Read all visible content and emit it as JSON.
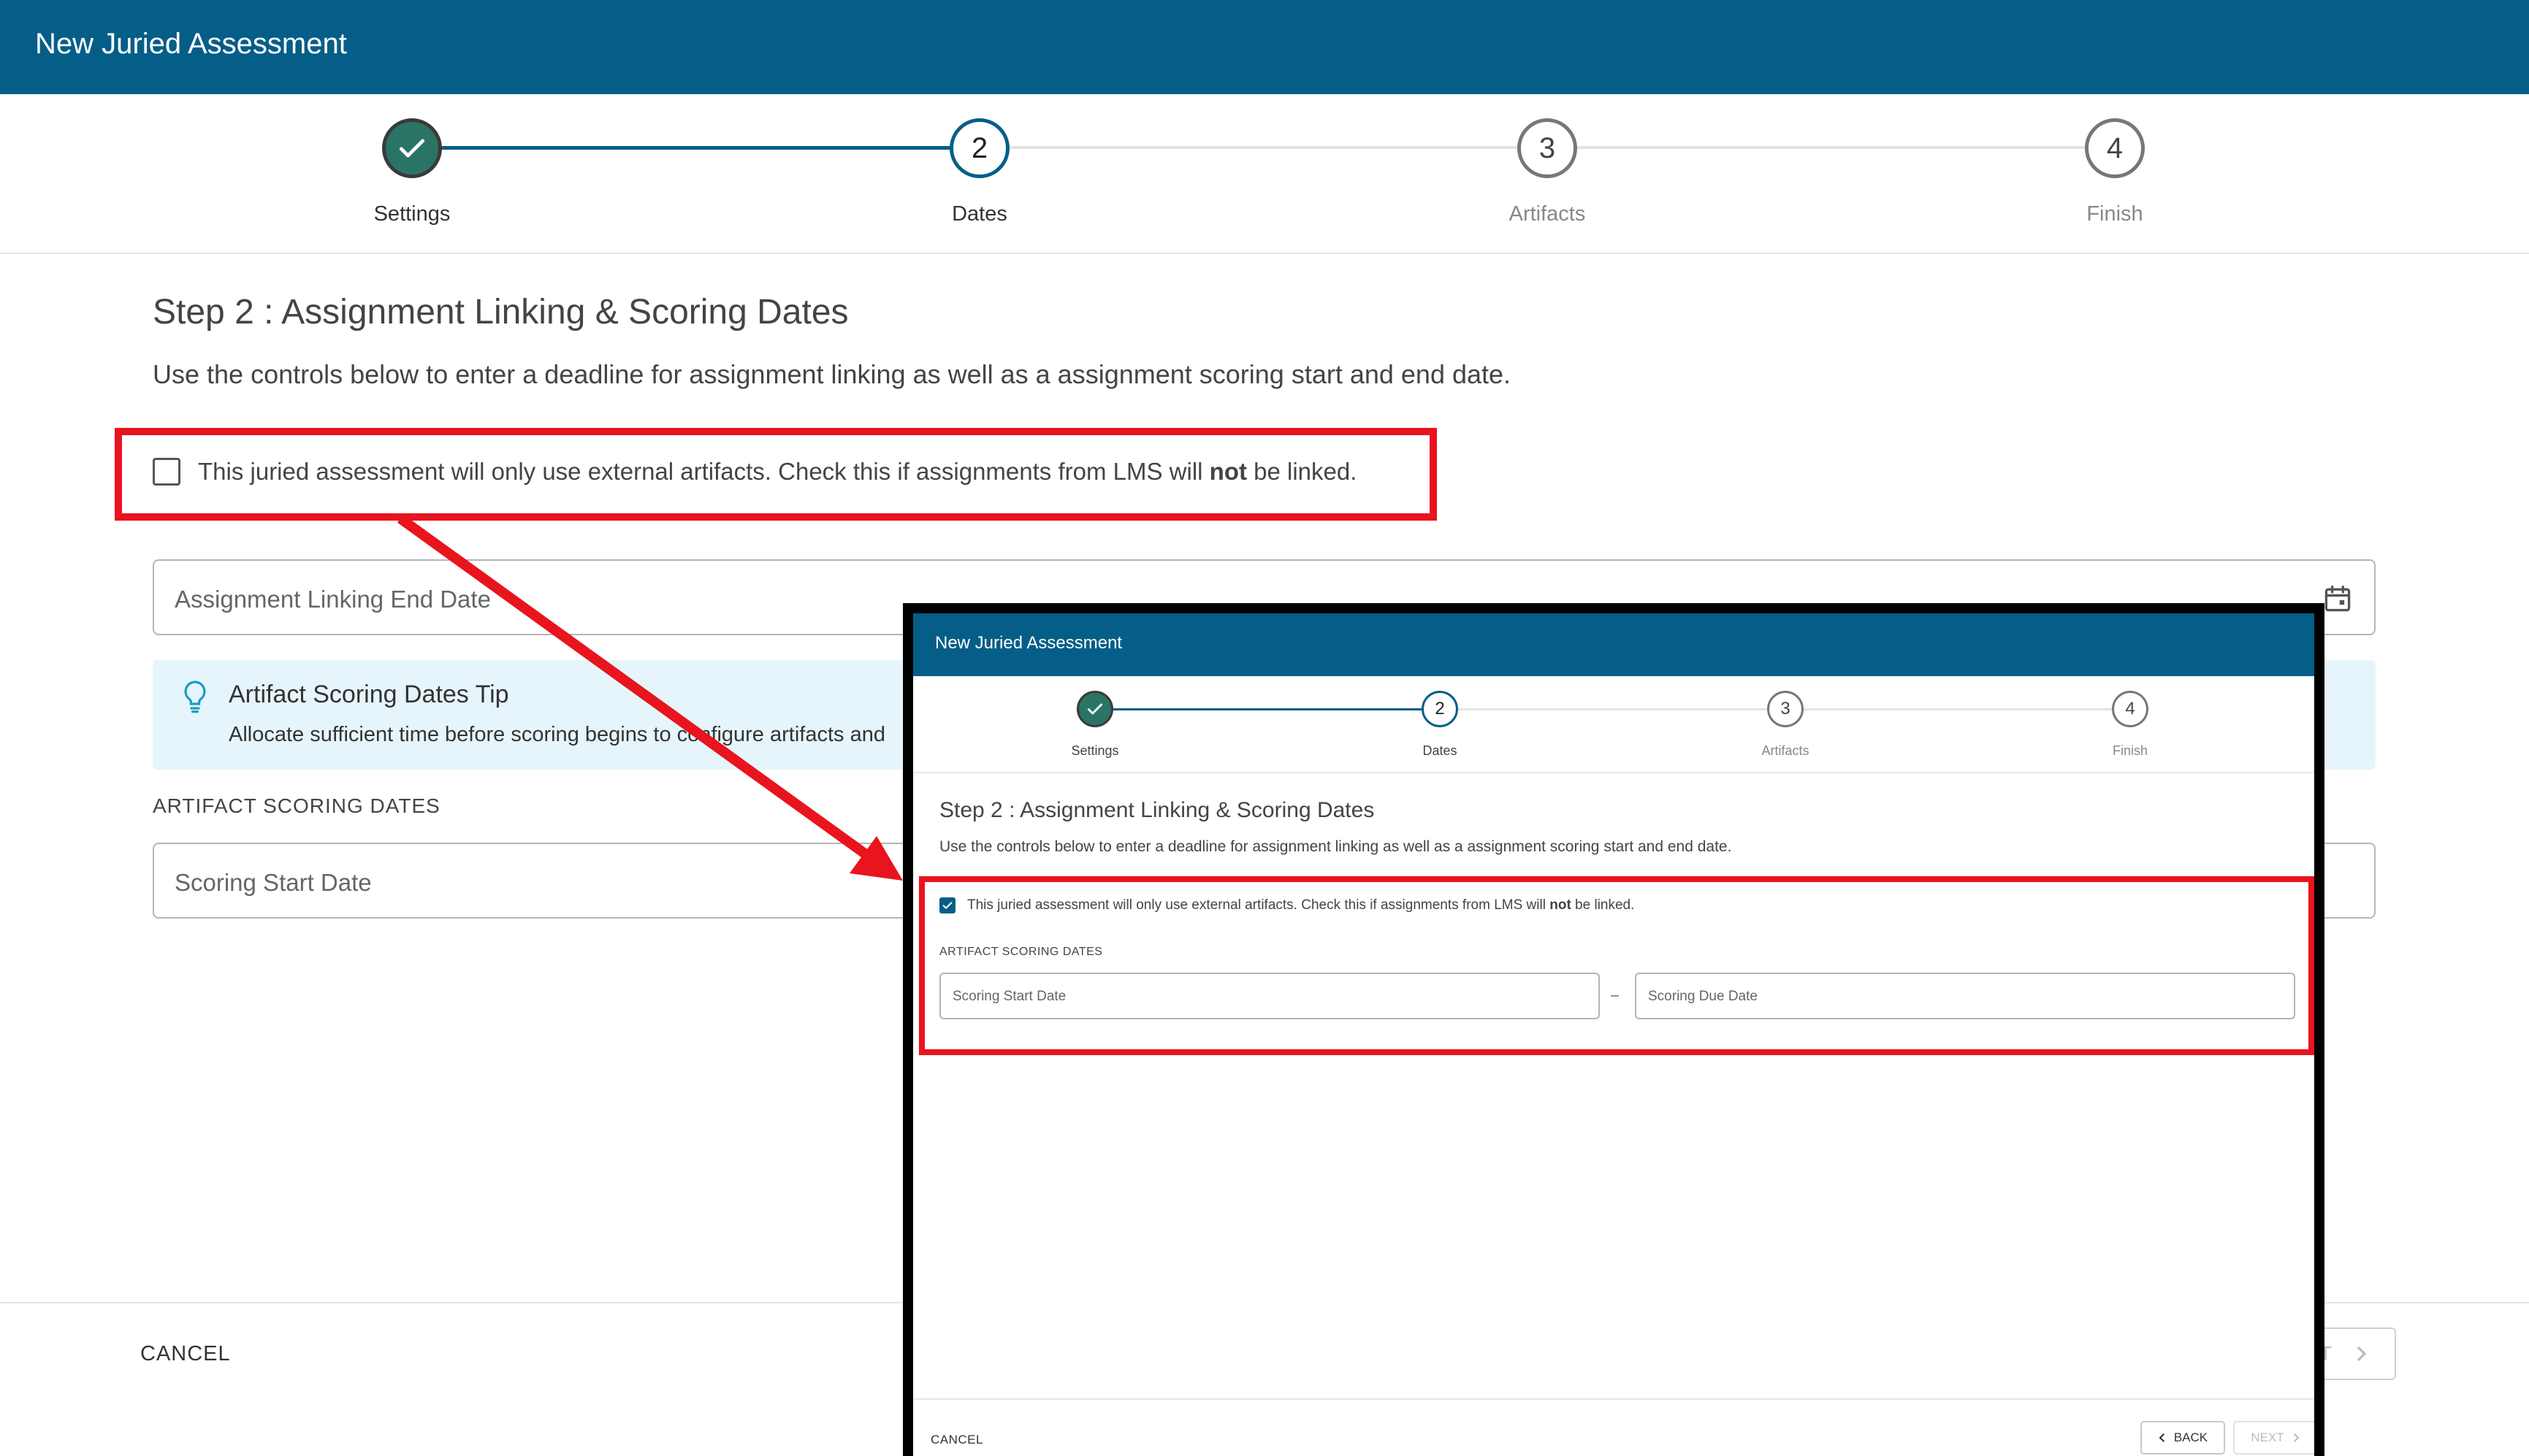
{
  "app": {
    "title": "New Juried Assessment"
  },
  "stepper": {
    "steps": [
      {
        "number": "1",
        "label": "Settings",
        "state": "completed"
      },
      {
        "number": "2",
        "label": "Dates",
        "state": "active"
      },
      {
        "number": "3",
        "label": "Artifacts",
        "state": "pending"
      },
      {
        "number": "4",
        "label": "Finish",
        "state": "pending"
      }
    ]
  },
  "main": {
    "step_title": "Step 2 : Assignment Linking & Scoring Dates",
    "step_description": "Use the controls below to enter a deadline for assignment linking as well as a assignment scoring start and end date.",
    "external_checkbox": {
      "label_before": "This juried assessment will only use external artifacts. Check this if assignments from LMS will ",
      "label_bold": "not",
      "label_after": " be linked.",
      "checked": false
    },
    "linking_end_date_placeholder": "Assignment Linking End Date",
    "tip": {
      "title": "Artifact Scoring Dates Tip",
      "text": "Allocate sufficient time before scoring begins to configure artifacts and"
    },
    "scoring_section_label": "ARTIFACT SCORING DATES",
    "scoring_start_placeholder": "Scoring Start Date"
  },
  "footer": {
    "cancel_label": "CANCEL",
    "next_label_partial": "T"
  },
  "inset": {
    "header_title": "New Juried Assessment",
    "step_title": "Step 2 : Assignment Linking & Scoring Dates",
    "step_description": "Use the controls below to enter a deadline for assignment linking as well as a assignment scoring start and end date.",
    "external_checkbox": {
      "label_before": "This juried assessment will only use external artifacts. Check this if assignments from LMS will ",
      "label_bold": "not",
      "label_after": " be linked.",
      "checked": true
    },
    "scoring_section_label": "ARTIFACT SCORING DATES",
    "scoring_start_placeholder": "Scoring Start Date",
    "date_separator": "–",
    "scoring_due_placeholder": "Scoring Due Date",
    "cancel_label": "CANCEL",
    "back_label": "BACK",
    "next_label": "NEXT"
  },
  "colors": {
    "brand": "#055e87",
    "completed": "#2a7466",
    "annotation_red": "#e8141e",
    "tip_background": "#e6f5fb"
  }
}
